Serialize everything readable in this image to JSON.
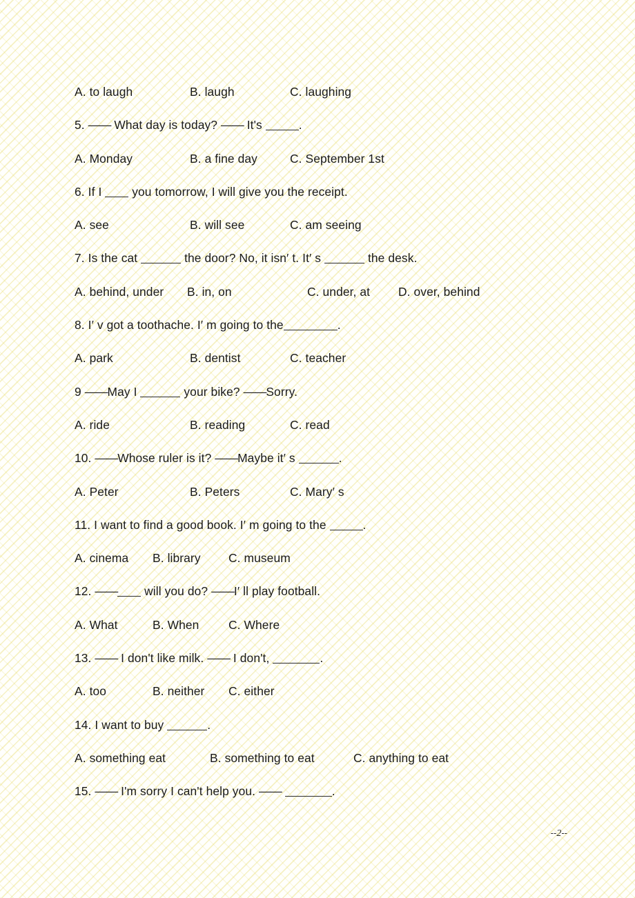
{
  "document": {
    "type": "multiple-choice-worksheet",
    "subject": "English grammar",
    "page_footer": {
      "left_dashes": "--",
      "number": "2",
      "right_dashes": "--"
    }
  },
  "lines": [
    {
      "id": "q4-options",
      "kind": "options",
      "layout": "default",
      "options": [
        {
          "label": "A. to laugh"
        },
        {
          "label": "B. laugh"
        },
        {
          "label": "C. laughing"
        }
      ]
    },
    {
      "id": "q5-stem",
      "kind": "question",
      "number": "5.",
      "segments": [
        {
          "type": "text",
          "text": " "
        },
        {
          "type": "dash",
          "text": "——"
        },
        {
          "type": "text",
          "text": " What day is today? "
        },
        {
          "type": "dash",
          "text": "——"
        },
        {
          "type": "text",
          "text": " It's "
        },
        {
          "type": "blank",
          "size": "sm"
        },
        {
          "type": "text",
          "text": "."
        }
      ]
    },
    {
      "id": "q5-options",
      "kind": "options",
      "layout": "default",
      "options": [
        {
          "label": "A. Monday"
        },
        {
          "label": "B. a fine day"
        },
        {
          "label": "C. September 1st"
        }
      ]
    },
    {
      "id": "q6-stem",
      "kind": "question",
      "number": "6.",
      "segments": [
        {
          "type": "text",
          "text": " If I "
        },
        {
          "type": "blank",
          "size": "xs"
        },
        {
          "type": "text",
          "text": " you tomorrow, I will give you the receipt."
        }
      ]
    },
    {
      "id": "q6-options",
      "kind": "options",
      "layout": "default",
      "options": [
        {
          "label": "A. see"
        },
        {
          "label": "B. will see"
        },
        {
          "label": "C. am seeing"
        }
      ]
    },
    {
      "id": "q7-stem",
      "kind": "question",
      "number": "7.",
      "segments": [
        {
          "type": "text",
          "text": " Is the cat "
        },
        {
          "type": "blank",
          "size": "md"
        },
        {
          "type": "text",
          "text": " the door?    No, it isn′ t. It′ s "
        },
        {
          "type": "blank",
          "size": "md"
        },
        {
          "type": "text",
          "text": " the desk."
        }
      ]
    },
    {
      "id": "q7-options",
      "kind": "options",
      "layout": "q7",
      "options": [
        {
          "label": "A. behind, under"
        },
        {
          "label": "B. in, on"
        },
        {
          "label": "C. under, at"
        },
        {
          "label": "D. over, behind"
        }
      ]
    },
    {
      "id": "q8-stem",
      "kind": "question",
      "number": "8.",
      "segments": [
        {
          "type": "text",
          "text": " I′ v got a toothache. I′ m going to the"
        },
        {
          "type": "blank",
          "size": "xl"
        },
        {
          "type": "text",
          "text": "."
        }
      ]
    },
    {
      "id": "q8-options",
      "kind": "options",
      "layout": "default",
      "options": [
        {
          "label": "A. park"
        },
        {
          "label": "B. dentist"
        },
        {
          "label": "C. teacher"
        }
      ]
    },
    {
      "id": "q9-stem",
      "kind": "question",
      "number": "9",
      "segments": [
        {
          "type": "text",
          "text": " "
        },
        {
          "type": "dash",
          "text": "——"
        },
        {
          "type": "text",
          "text": "May I "
        },
        {
          "type": "blank",
          "size": "md"
        },
        {
          "type": "text",
          "text": " your bike?   "
        },
        {
          "type": "dash",
          "text": "——"
        },
        {
          "type": "text",
          "text": "Sorry."
        }
      ]
    },
    {
      "id": "q9-options",
      "kind": "options",
      "layout": "default",
      "options": [
        {
          "label": "A. ride"
        },
        {
          "label": "B. reading"
        },
        {
          "label": "C. read"
        }
      ]
    },
    {
      "id": "q10-stem",
      "kind": "question",
      "number": "10.",
      "segments": [
        {
          "type": "text",
          "text": " "
        },
        {
          "type": "dash",
          "text": "——"
        },
        {
          "type": "text",
          "text": "Whose ruler is it?   "
        },
        {
          "type": "dash",
          "text": "——"
        },
        {
          "type": "text",
          "text": "Maybe it′ s "
        },
        {
          "type": "blank",
          "size": "md"
        },
        {
          "type": "text",
          "text": "."
        }
      ]
    },
    {
      "id": "q10-options",
      "kind": "options",
      "layout": "default",
      "options": [
        {
          "label": "A. Peter"
        },
        {
          "label": "B. Peters"
        },
        {
          "label": "C. Mary′ s"
        }
      ]
    },
    {
      "id": "q11-stem",
      "kind": "question",
      "number": "11.",
      "segments": [
        {
          "type": "text",
          "text": " I want to find a good book. I′ m going to the "
        },
        {
          "type": "blank",
          "size": "sm"
        },
        {
          "type": "text",
          "text": "."
        }
      ]
    },
    {
      "id": "q11-options",
      "kind": "options",
      "layout": "tight",
      "options": [
        {
          "label": "A. cinema"
        },
        {
          "label": "B. library"
        },
        {
          "label": "C. museum"
        }
      ]
    },
    {
      "id": "q12-stem",
      "kind": "question",
      "number": "12.",
      "segments": [
        {
          "type": "text",
          "text": " "
        },
        {
          "type": "dash",
          "text": "——"
        },
        {
          "type": "blank",
          "size": "xs"
        },
        {
          "type": "text",
          "text": " will you do?   "
        },
        {
          "type": "dash",
          "text": "——"
        },
        {
          "type": "text",
          "text": "I′ ll play football."
        }
      ]
    },
    {
      "id": "q12-options",
      "kind": "options",
      "layout": "tight",
      "options": [
        {
          "label": "A. What"
        },
        {
          "label": "B. When"
        },
        {
          "label": "C. Where"
        }
      ]
    },
    {
      "id": "q13-stem",
      "kind": "question",
      "number": "13.",
      "segments": [
        {
          "type": "text",
          "text": " "
        },
        {
          "type": "dash",
          "text": "——"
        },
        {
          "type": "text",
          "text": " I don't like milk. "
        },
        {
          "type": "dash",
          "text": "——"
        },
        {
          "type": "text",
          "text": " I don't, "
        },
        {
          "type": "blank",
          "size": "lg"
        },
        {
          "type": "text",
          "text": "."
        }
      ]
    },
    {
      "id": "q13-options",
      "kind": "options",
      "layout": "tight",
      "options": [
        {
          "label": "A. too"
        },
        {
          "label": "B. neither"
        },
        {
          "label": "C. either"
        }
      ]
    },
    {
      "id": "q14-stem",
      "kind": "question",
      "number": "14.",
      "segments": [
        {
          "type": "text",
          "text": " I want to buy "
        },
        {
          "type": "blank",
          "size": "md"
        },
        {
          "type": "text",
          "text": "."
        }
      ]
    },
    {
      "id": "q14-options",
      "kind": "options",
      "layout": "wide",
      "options": [
        {
          "label": "A. something eat"
        },
        {
          "label": "B. something to eat"
        },
        {
          "label": "C. anything to eat"
        }
      ]
    },
    {
      "id": "q15-stem",
      "kind": "question",
      "number": "15.",
      "segments": [
        {
          "type": "text",
          "text": " "
        },
        {
          "type": "dash",
          "text": "——"
        },
        {
          "type": "text",
          "text": " I'm sorry I can't help you. "
        },
        {
          "type": "dash",
          "text": "——"
        },
        {
          "type": "text",
          "text": " "
        },
        {
          "type": "blank",
          "size": "lg"
        },
        {
          "type": "text",
          "text": "."
        }
      ]
    }
  ]
}
